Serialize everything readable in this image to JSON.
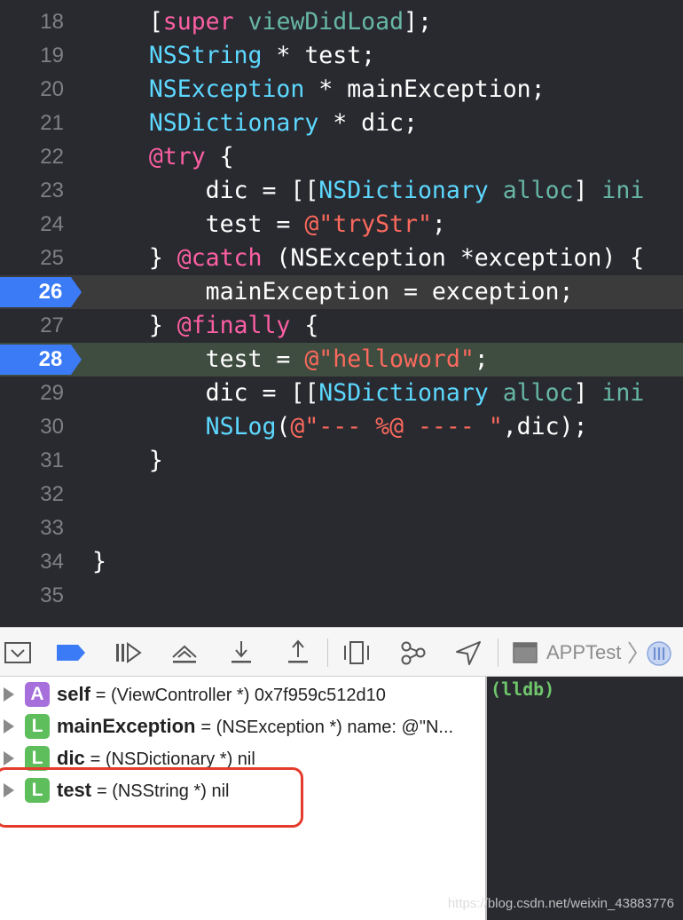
{
  "editor": {
    "lines": [
      {
        "num": "18",
        "tokens": [
          {
            "c": "p",
            "t": "    ["
          },
          {
            "c": "k",
            "t": "super"
          },
          {
            "c": "p",
            "t": " "
          },
          {
            "c": "m",
            "t": "viewDidLoad"
          },
          {
            "c": "p",
            "t": "];"
          }
        ]
      },
      {
        "num": "19",
        "tokens": [
          {
            "c": "p",
            "t": "    "
          },
          {
            "c": "t",
            "t": "NSString"
          },
          {
            "c": "p",
            "t": " * test;"
          }
        ]
      },
      {
        "num": "20",
        "tokens": [
          {
            "c": "p",
            "t": "    "
          },
          {
            "c": "t",
            "t": "NSException"
          },
          {
            "c": "p",
            "t": " * mainException;"
          }
        ]
      },
      {
        "num": "21",
        "tokens": [
          {
            "c": "p",
            "t": "    "
          },
          {
            "c": "t",
            "t": "NSDictionary"
          },
          {
            "c": "p",
            "t": " * dic;"
          }
        ]
      },
      {
        "num": "22",
        "tokens": [
          {
            "c": "p",
            "t": "    "
          },
          {
            "c": "k",
            "t": "@try"
          },
          {
            "c": "p",
            "t": " {"
          }
        ]
      },
      {
        "num": "23",
        "tokens": [
          {
            "c": "p",
            "t": "        dic = [["
          },
          {
            "c": "t",
            "t": "NSDictionary"
          },
          {
            "c": "p",
            "t": " "
          },
          {
            "c": "m",
            "t": "alloc"
          },
          {
            "c": "p",
            "t": "] "
          },
          {
            "c": "m",
            "t": "ini"
          }
        ]
      },
      {
        "num": "24",
        "tokens": [
          {
            "c": "p",
            "t": "        test = "
          },
          {
            "c": "s",
            "t": "@\"tryStr\""
          },
          {
            "c": "p",
            "t": ";"
          }
        ]
      },
      {
        "num": "25",
        "tokens": [
          {
            "c": "p",
            "t": "    } "
          },
          {
            "c": "k",
            "t": "@catch"
          },
          {
            "c": "p",
            "t": " (NSException *exception) {"
          }
        ]
      },
      {
        "num": "26",
        "breakpoint": true,
        "highlight": "hl-26",
        "tokens": [
          {
            "c": "p",
            "t": "        mainException = exception;"
          }
        ]
      },
      {
        "num": "27",
        "tokens": [
          {
            "c": "p",
            "t": "    } "
          },
          {
            "c": "k",
            "t": "@finally"
          },
          {
            "c": "p",
            "t": " {"
          }
        ]
      },
      {
        "num": "28",
        "breakpoint": true,
        "highlight": "hl-28",
        "tokens": [
          {
            "c": "p",
            "t": "        test = "
          },
          {
            "c": "s",
            "t": "@\"helloword\""
          },
          {
            "c": "p",
            "t": ";"
          }
        ]
      },
      {
        "num": "29",
        "tokens": [
          {
            "c": "p",
            "t": "        dic = [["
          },
          {
            "c": "t",
            "t": "NSDictionary"
          },
          {
            "c": "p",
            "t": " "
          },
          {
            "c": "m",
            "t": "alloc"
          },
          {
            "c": "p",
            "t": "] "
          },
          {
            "c": "m",
            "t": "ini"
          }
        ]
      },
      {
        "num": "30",
        "tokens": [
          {
            "c": "p",
            "t": "        "
          },
          {
            "c": "t",
            "t": "NSLog"
          },
          {
            "c": "p",
            "t": "("
          },
          {
            "c": "s",
            "t": "@\"--- %@ ---- \""
          },
          {
            "c": "p",
            "t": ",dic);"
          }
        ]
      },
      {
        "num": "31",
        "tokens": [
          {
            "c": "p",
            "t": "    }"
          }
        ]
      },
      {
        "num": "32",
        "tokens": []
      },
      {
        "num": "33",
        "tokens": []
      },
      {
        "num": "34",
        "tokens": [
          {
            "c": "p",
            "t": "}"
          }
        ]
      },
      {
        "num": "35",
        "tokens": []
      }
    ]
  },
  "debugbar": {
    "buttons": [
      {
        "name": "toggle-debug-area-button",
        "icon": "panel-down-icon"
      },
      {
        "name": "breakpoints-toggle-button",
        "icon": "breakpoint-icon"
      },
      {
        "name": "continue-button",
        "icon": "continue-icon"
      },
      {
        "name": "step-over-button",
        "icon": "step-over-icon"
      },
      {
        "name": "step-into-button",
        "icon": "step-into-icon"
      },
      {
        "name": "step-out-button",
        "icon": "step-out-icon"
      },
      {
        "name": "debug-view-hierarchy-button",
        "icon": "view-hierarchy-icon"
      },
      {
        "name": "memory-graph-button",
        "icon": "memory-graph-icon"
      },
      {
        "name": "simulate-location-button",
        "icon": "location-icon"
      }
    ],
    "process": "APPTest",
    "accent": "#3c7bf6"
  },
  "variables": [
    {
      "badge": "A",
      "name": "self",
      "value": "= (ViewController *) 0x7f959c512d10"
    },
    {
      "badge": "L",
      "name": "mainException",
      "value": "= (NSException *) name: @\"N..."
    },
    {
      "badge": "L",
      "name": "dic",
      "value": "= (NSDictionary *) nil"
    },
    {
      "badge": "L",
      "name": "test",
      "value": "= (NSString *) nil"
    }
  ],
  "console": {
    "prompt": "(lldb)",
    "watermark": "https://blog.csdn.net/weixin_43883776"
  }
}
